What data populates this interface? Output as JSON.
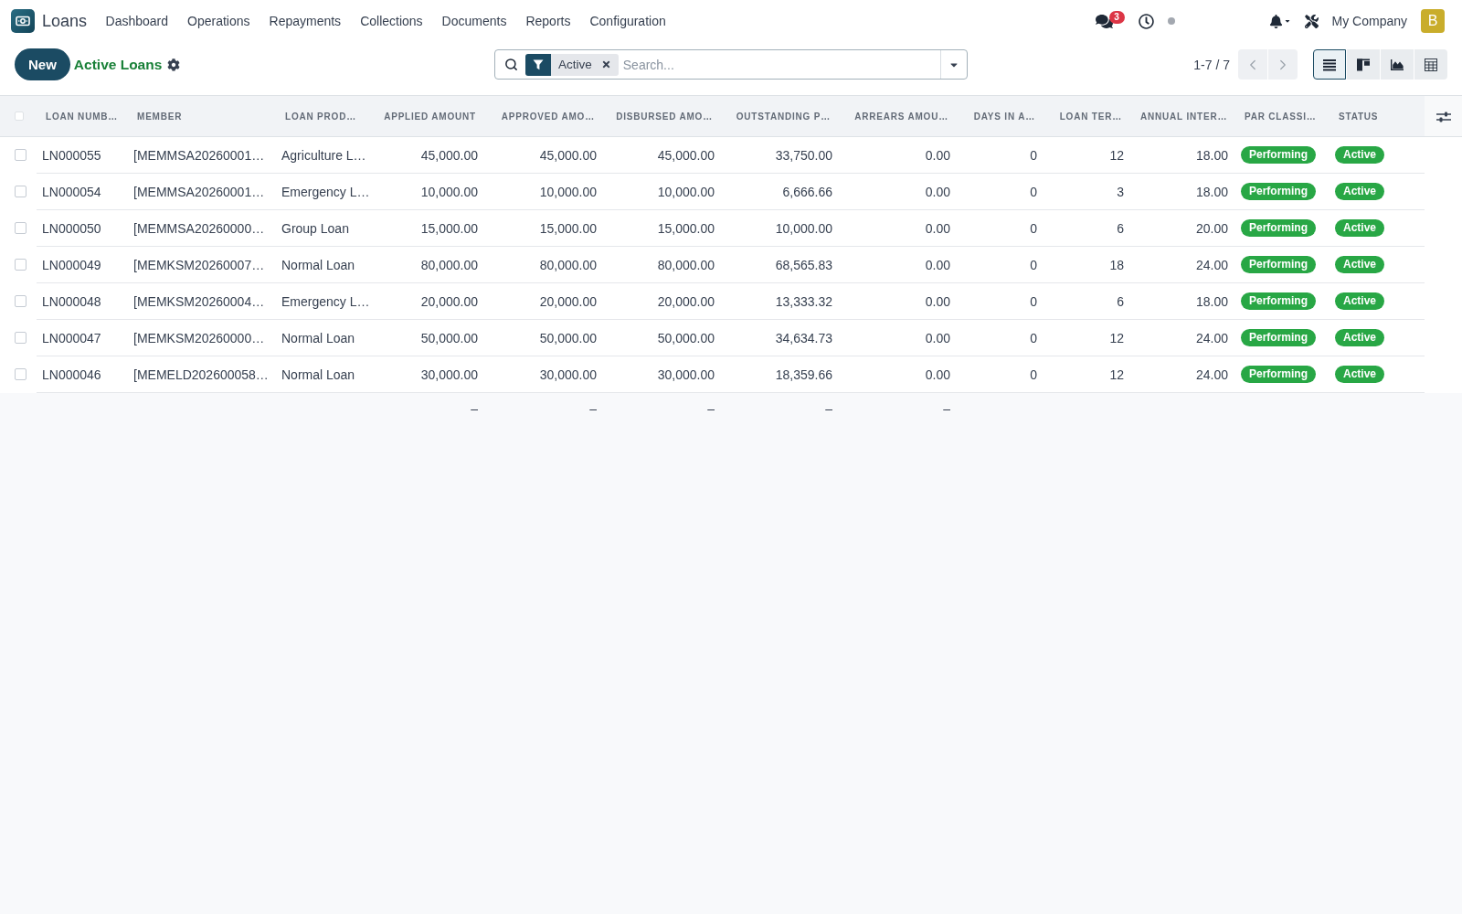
{
  "navbar": {
    "app_name": "Loans",
    "menu": [
      "Dashboard",
      "Operations",
      "Repayments",
      "Collections",
      "Documents",
      "Reports",
      "Configuration"
    ],
    "messages_badge": "3",
    "company": "My Company",
    "avatar_initial": "B"
  },
  "control_panel": {
    "new_button": "New",
    "title": "Active Loans",
    "search": {
      "facets": [
        {
          "label": "Active"
        }
      ],
      "placeholder": "Search..."
    },
    "pager": "1-7 / 7",
    "views": [
      {
        "kind": "list",
        "selected": true
      },
      {
        "kind": "kanban",
        "selected": false
      },
      {
        "kind": "graph",
        "selected": false
      },
      {
        "kind": "pivot",
        "selected": false
      }
    ]
  },
  "table": {
    "select_all": {
      "checked": false
    },
    "columns": [
      {
        "label": "LOAN NUMB…",
        "kind": "text"
      },
      {
        "label": "MEMBER",
        "kind": "text"
      },
      {
        "label": "LOAN PROD…",
        "kind": "text"
      },
      {
        "label": "APPLIED AMOUNT",
        "kind": "number",
        "total": "–"
      },
      {
        "label": "APPROVED AMO…",
        "kind": "number",
        "total": "–"
      },
      {
        "label": "DISBURSED AMO…",
        "kind": "number",
        "total": "–"
      },
      {
        "label": "OUTSTANDING P…",
        "kind": "number",
        "total": "–"
      },
      {
        "label": "ARREARS AMOU…",
        "kind": "number",
        "total": "–"
      },
      {
        "label": "DAYS IN A…",
        "kind": "number"
      },
      {
        "label": "LOAN TER…",
        "kind": "number"
      },
      {
        "label": "ANNUAL INTER…",
        "kind": "number"
      },
      {
        "label": "PAR CLASSI…",
        "kind": "badge"
      },
      {
        "label": "STATUS",
        "kind": "badge"
      }
    ],
    "rows": [
      {
        "selected": false,
        "cells": [
          "LN000055",
          "[MEMMSA20260001…",
          "Agriculture L…",
          "45,000.00",
          "45,000.00",
          "45,000.00",
          "33,750.00",
          "0.00",
          "0",
          "12",
          "18.00",
          "Performing",
          "Active"
        ]
      },
      {
        "selected": false,
        "cells": [
          "LN000054",
          "[MEMMSA20260001…",
          "Emergency L…",
          "10,000.00",
          "10,000.00",
          "10,000.00",
          "6,666.66",
          "0.00",
          "0",
          "3",
          "18.00",
          "Performing",
          "Active"
        ]
      },
      {
        "selected": false,
        "cells": [
          "LN000050",
          "[MEMMSA20260000…",
          "Group Loan",
          "15,000.00",
          "15,000.00",
          "15,000.00",
          "10,000.00",
          "0.00",
          "0",
          "6",
          "20.00",
          "Performing",
          "Active"
        ]
      },
      {
        "selected": false,
        "cells": [
          "LN000049",
          "[MEMKSM20260007…",
          "Normal Loan",
          "80,000.00",
          "80,000.00",
          "80,000.00",
          "68,565.83",
          "0.00",
          "0",
          "18",
          "24.00",
          "Performing",
          "Active"
        ]
      },
      {
        "selected": false,
        "cells": [
          "LN000048",
          "[MEMKSM20260004…",
          "Emergency L…",
          "20,000.00",
          "20,000.00",
          "20,000.00",
          "13,333.32",
          "0.00",
          "0",
          "6",
          "18.00",
          "Performing",
          "Active"
        ]
      },
      {
        "selected": false,
        "cells": [
          "LN000047",
          "[MEMKSM20260000…",
          "Normal Loan",
          "50,000.00",
          "50,000.00",
          "50,000.00",
          "34,634.73",
          "0.00",
          "0",
          "12",
          "24.00",
          "Performing",
          "Active"
        ]
      },
      {
        "selected": false,
        "cells": [
          "LN000046",
          "[MEMELD202600058…",
          "Normal Loan",
          "30,000.00",
          "30,000.00",
          "30,000.00",
          "18,359.66",
          "0.00",
          "0",
          "12",
          "24.00",
          "Performing",
          "Active"
        ]
      }
    ]
  }
}
